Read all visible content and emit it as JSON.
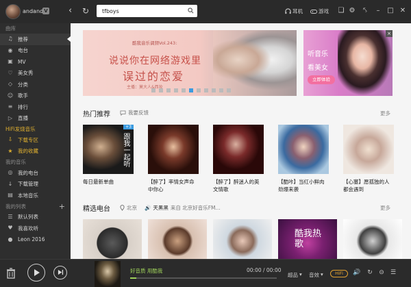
{
  "header": {
    "username": "andand",
    "vip_badge": "V",
    "search_value": "tfboys",
    "earphone_label": "耳机",
    "game_label": "游戏"
  },
  "sidebar": {
    "section_library": "曲库",
    "library_items": [
      {
        "label": "推荐",
        "icon": "music-note-icon"
      },
      {
        "label": "电台",
        "icon": "radio-icon"
      },
      {
        "label": "MV",
        "icon": "mv-icon"
      },
      {
        "label": "美女秀",
        "icon": "heart-person-icon"
      },
      {
        "label": "分类",
        "icon": "tag-icon"
      },
      {
        "label": "歌手",
        "icon": "singer-icon"
      },
      {
        "label": "排行",
        "icon": "rank-icon"
      },
      {
        "label": "直播",
        "icon": "live-icon"
      }
    ],
    "section_hifi": "HiFi发烧音乐",
    "hifi_items": [
      {
        "label": "下载专区",
        "icon": "download-zone-icon"
      },
      {
        "label": "我的收藏",
        "icon": "star-icon"
      }
    ],
    "section_my_music": "我的音乐",
    "my_music_items": [
      {
        "label": "我的电台",
        "icon": "my-radio-icon"
      },
      {
        "label": "下载管理",
        "icon": "download-icon"
      },
      {
        "label": "本地音乐",
        "icon": "local-music-icon"
      }
    ],
    "section_playlists": "我的列表",
    "playlist_items": [
      {
        "label": "默认列表",
        "icon": "list-icon"
      },
      {
        "label": "我喜欢听",
        "icon": "heart-icon"
      },
      {
        "label": "Leon 2016",
        "icon": "disc-icon"
      }
    ]
  },
  "banner": {
    "tag": "酷我音乐调频Vol.243:",
    "line1": "说说你在网络游戏里",
    "line2": "误过的恋爱",
    "subtitle": "主播：莫大人&西妆",
    "active_dot": 5,
    "dot_count": 11
  },
  "ad": {
    "line1": "听音乐",
    "line2": "看美女",
    "button": "立即体验",
    "close": "×"
  },
  "hot": {
    "title": "热门推荐",
    "feedback": "我要反馈",
    "more": "更多",
    "tiles": [
      {
        "caption": "每日最新单曲",
        "badge": "+3",
        "cover_text": "跟我一起听"
      },
      {
        "caption": "【醉了】率情女声命中你心",
        "badge": "",
        "cover_text": ""
      },
      {
        "caption": "【醉了】醉迷人的英文情歌",
        "badge": "",
        "cover_text": ""
      },
      {
        "caption": "【酷咔】当红小鲜肉劲爆来袭",
        "badge": "",
        "cover_text": ""
      },
      {
        "caption": "【心塞】愿孤独的人都会遇到",
        "badge": "",
        "cover_text": ""
      }
    ]
  },
  "radio": {
    "title": "精选电台",
    "location": "北京",
    "now_playing": "天黑黑",
    "from_label": "来自 北京好音乐FM...",
    "more": "更多",
    "cover_texts": [
      "",
      "",
      "",
      "酷我热歌",
      ""
    ]
  },
  "player": {
    "title": "好音质 用酷我",
    "time": "00:00 / 00:00",
    "progress": 0.04,
    "quality_label": "超品",
    "effect_label": "音效",
    "hifi_label": "HiFi"
  },
  "colors": {
    "accent_green": "#9fd15a",
    "hifi_gold": "#e0a030",
    "dot_blue": "#3b9be0"
  }
}
